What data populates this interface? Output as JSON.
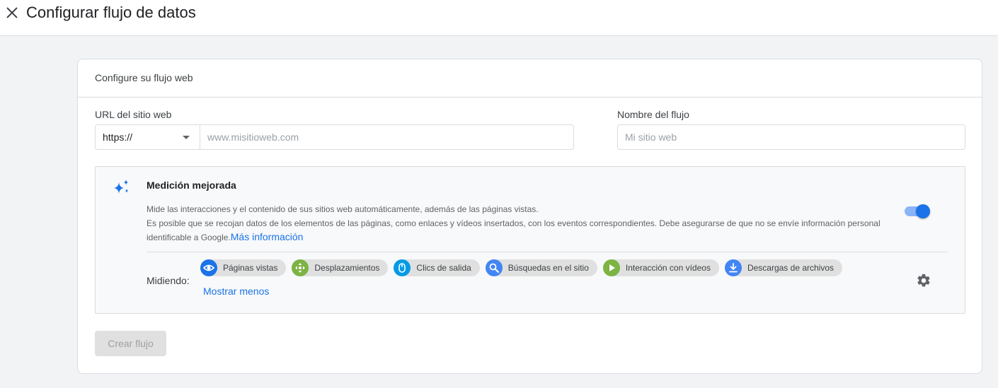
{
  "header": {
    "title": "Configurar flujo de datos"
  },
  "card": {
    "title": "Configure su flujo web",
    "url": {
      "label": "URL del sitio web",
      "protocol": "https://",
      "placeholder": "www.misitioweb.com"
    },
    "stream_name": {
      "label": "Nombre del flujo",
      "placeholder": "Mi sitio web"
    },
    "enhanced": {
      "title": "Medición mejorada",
      "description": "Mide las interacciones y el contenido de sus sitios web automáticamente, además de las páginas vistas.",
      "note": "Es posible que se recojan datos de los elementos de las páginas, como enlaces y vídeos insertados, con los eventos correspondientes. Debe asegurarse de que no se envíe información personal identificable a Google.",
      "more_link": "Más información",
      "enabled": true,
      "measuring_label": "Midiendo:",
      "chips": [
        {
          "label": "Páginas vistas",
          "icon": "eye-icon",
          "color": "#1a73e8"
        },
        {
          "label": "Desplazamientos",
          "icon": "scroll-arrows-icon",
          "color": "#7cb342"
        },
        {
          "label": "Clics de salida",
          "icon": "mouse-icon",
          "color": "#039be5"
        },
        {
          "label": "Búsquedas en el sitio",
          "icon": "search-icon",
          "color": "#4285f4"
        },
        {
          "label": "Interacción con vídeos",
          "icon": "play-icon",
          "color": "#7cb342"
        },
        {
          "label": "Descargas de archivos",
          "icon": "download-icon",
          "color": "#4285f4"
        }
      ],
      "show_less": "Mostrar menos"
    },
    "create_button": "Crear flujo"
  }
}
